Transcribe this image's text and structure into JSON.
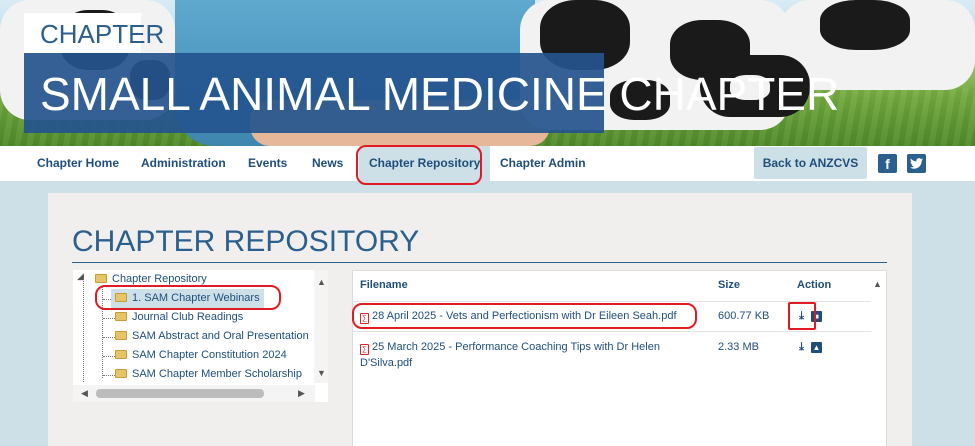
{
  "header": {
    "chapter_tag": "CHAPTER",
    "title": "SMALL ANIMAL MEDICINE CHAPTER"
  },
  "nav": {
    "items": [
      {
        "label": "Chapter Home"
      },
      {
        "label": "Administration"
      },
      {
        "label": "Events"
      },
      {
        "label": "News"
      },
      {
        "label": "Chapter Repository",
        "active": true
      },
      {
        "label": "Chapter Admin"
      }
    ],
    "back_label": "Back to ANZCVS",
    "facebook_icon": "facebook-icon",
    "twitter_icon": "twitter-icon"
  },
  "repository": {
    "title": "CHAPTER REPOSITORY",
    "tree": {
      "root": "Chapter Repository",
      "children": [
        {
          "label": "1. SAM Chapter Webinars",
          "selected": true
        },
        {
          "label": "Journal Club Readings"
        },
        {
          "label": "SAM Abstract and Oral Presentation"
        },
        {
          "label": "SAM Chapter Constitution 2024"
        },
        {
          "label": "SAM Chapter Member Scholarship"
        }
      ]
    },
    "table": {
      "headers": {
        "filename": "Filename",
        "size": "Size",
        "action": "Action"
      },
      "rows": [
        {
          "filename": "28 April 2025 - Vets and Perfectionism with Dr Eileen Seah.pdf",
          "size": "600.77 KB",
          "icons": [
            "download-icon",
            "preview-icon"
          ]
        },
        {
          "filename_line1": "25 March 2025 - Performance Coaching Tips with Dr Helen",
          "filename_line2": "D'Silva.pdf",
          "size": "2.33 MB",
          "icons": [
            "download-icon",
            "preview-icon"
          ]
        }
      ]
    }
  },
  "colors": {
    "brand_blue": "#2b5f8e",
    "nav_text": "#1f4e7a",
    "highlight_red": "#e01b24",
    "accent_light": "#cde0e8"
  }
}
